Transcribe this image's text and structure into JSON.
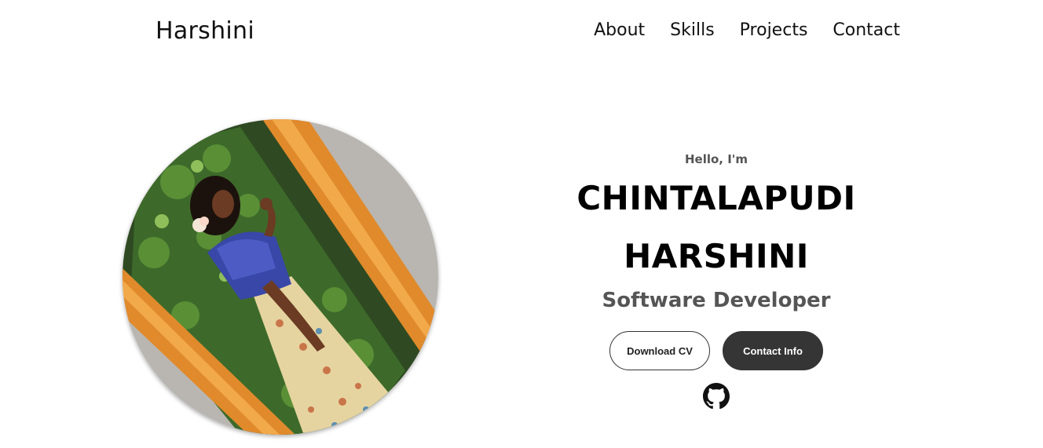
{
  "nav": {
    "logo": "Harshini",
    "links": [
      "About",
      "Skills",
      "Projects",
      "Contact"
    ]
  },
  "hero": {
    "greeting": "Hello, I'm",
    "name_line1": "CHINTALAPUDI",
    "name_line2": "HARSHINI",
    "role": "Software Developer",
    "buttons": {
      "download_cv": "Download CV",
      "contact_info": "Contact Info"
    },
    "social_icons": [
      "github-icon"
    ]
  },
  "colors": {
    "text_primary": "#000000",
    "text_secondary": "#555555",
    "button_dark": "#353535",
    "background": "#ffffff"
  }
}
